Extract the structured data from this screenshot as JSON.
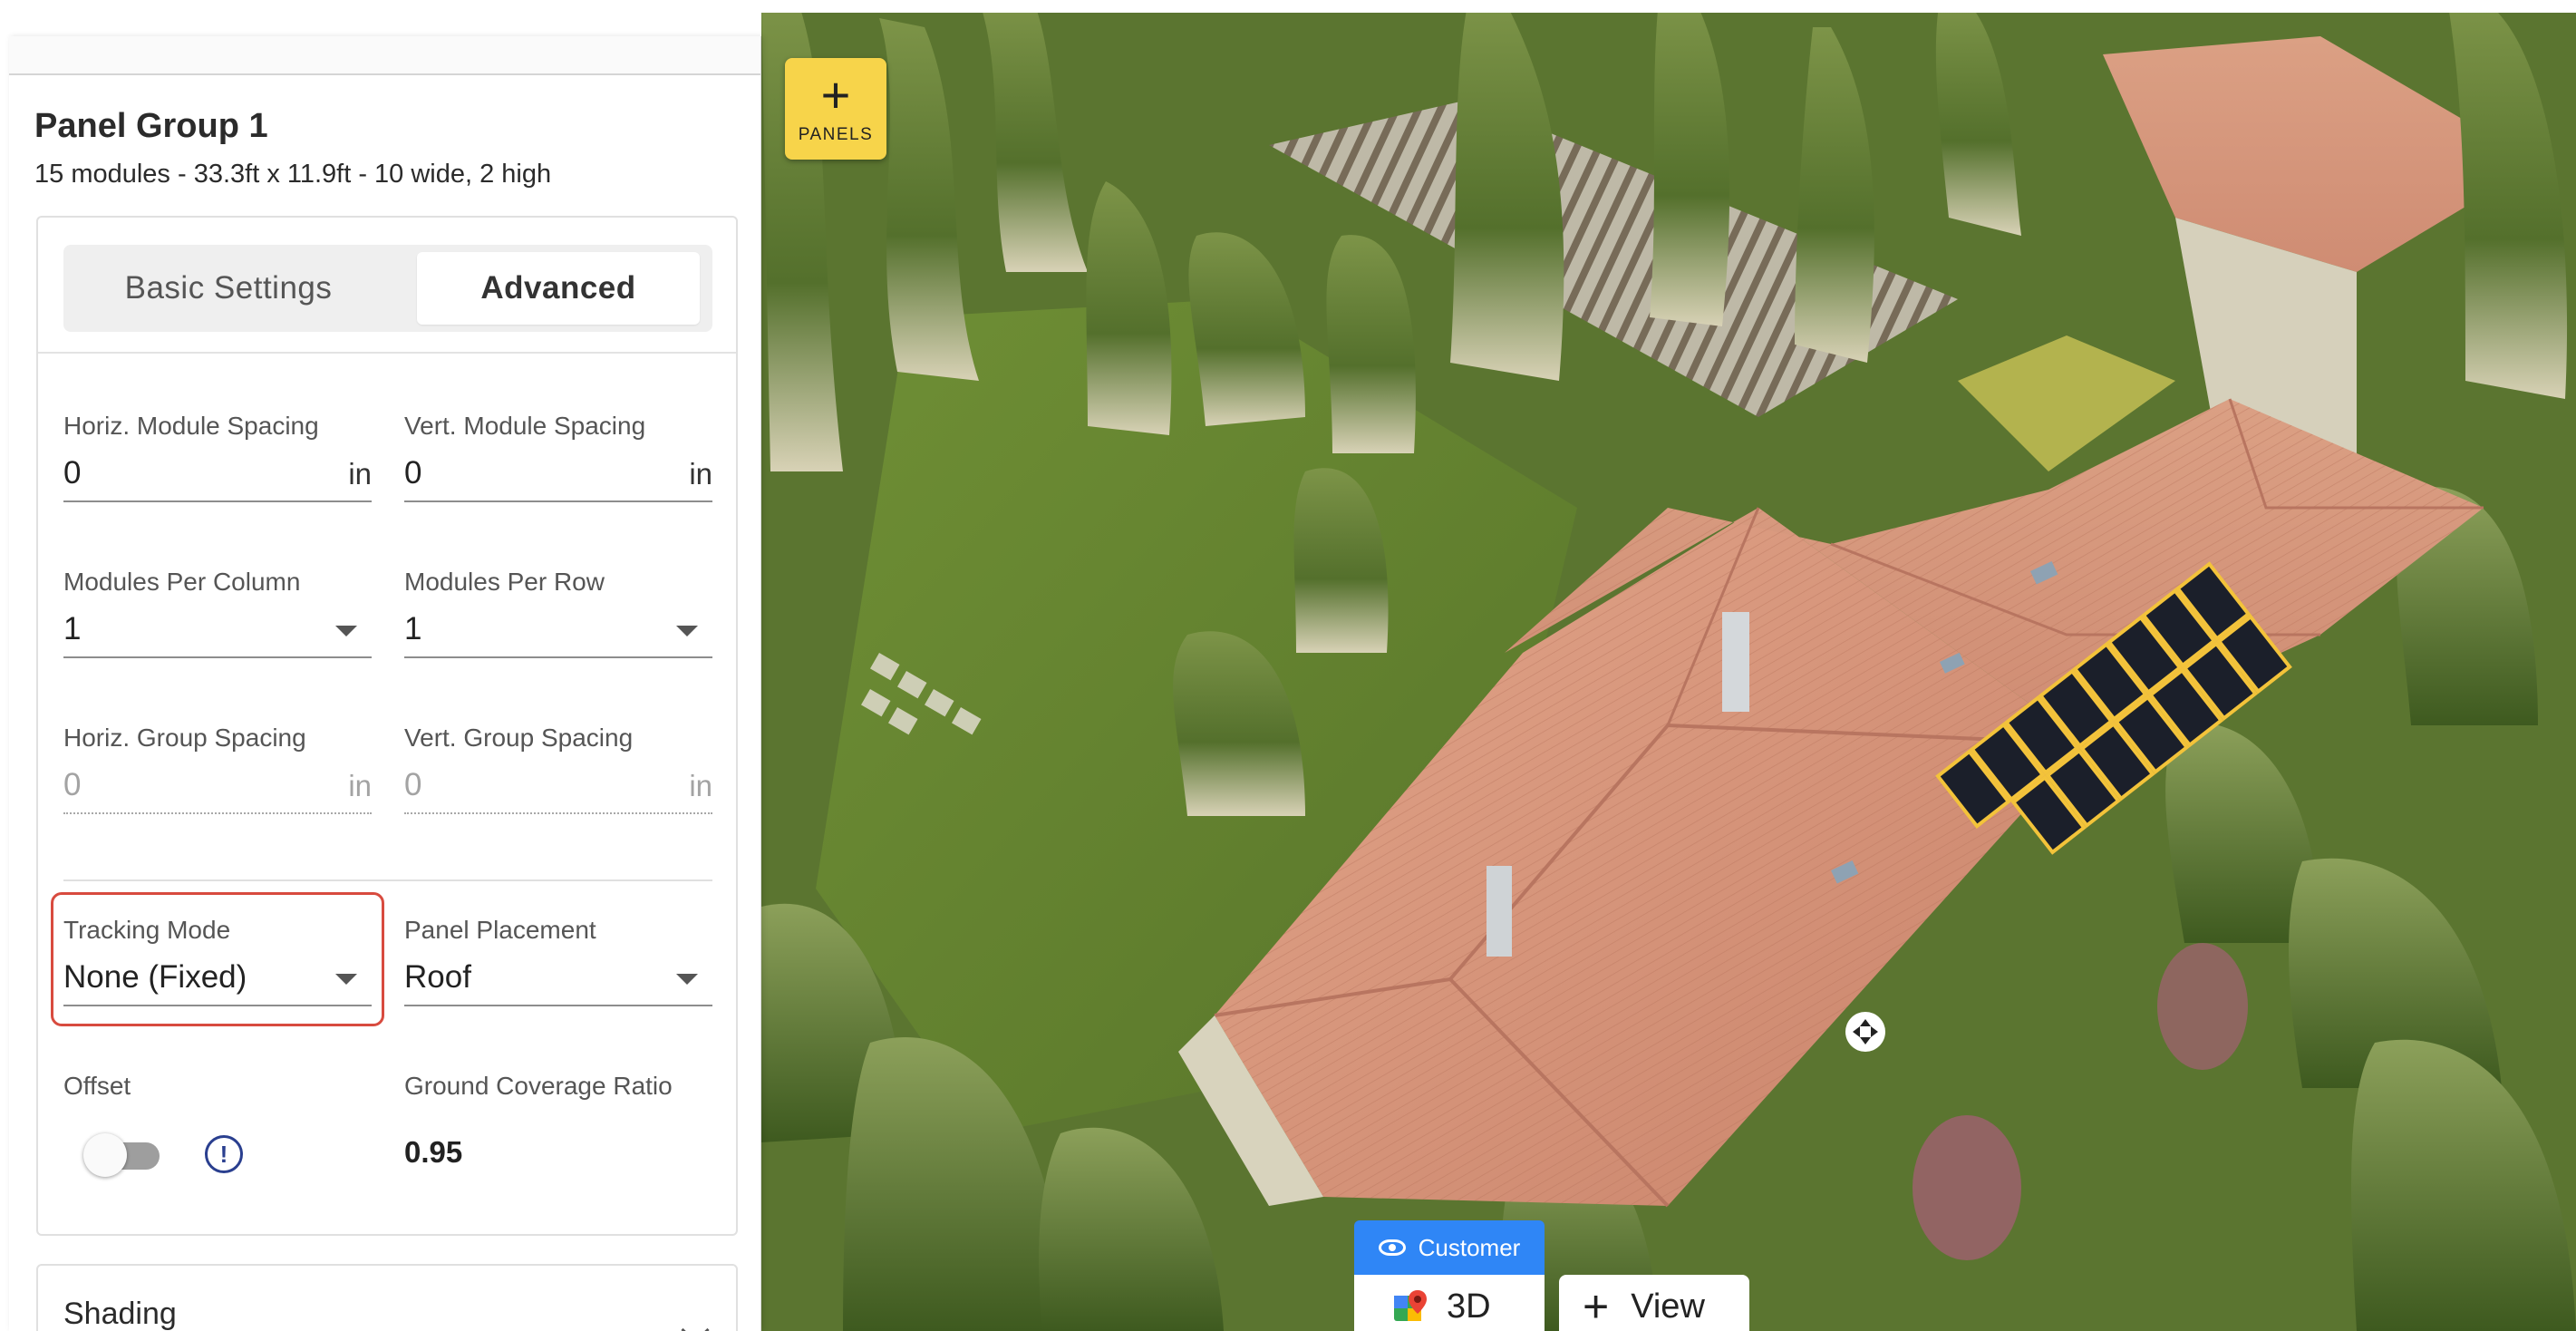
{
  "panel_group": {
    "title": "Panel Group 1",
    "subtitle": "15 modules - 33.3ft x 11.9ft - 10 wide, 2 high"
  },
  "tabs": {
    "basic": "Basic Settings",
    "advanced": "Advanced",
    "active": "Advanced"
  },
  "fields": {
    "horiz_module_spacing": {
      "label": "Horiz. Module Spacing",
      "value": "0",
      "unit": "in"
    },
    "vert_module_spacing": {
      "label": "Vert. Module Spacing",
      "value": "0",
      "unit": "in"
    },
    "modules_per_column": {
      "label": "Modules Per Column",
      "value": "1"
    },
    "modules_per_row": {
      "label": "Modules Per Row",
      "value": "1"
    },
    "horiz_group_spacing": {
      "label": "Horiz. Group Spacing",
      "value": "0",
      "unit": "in"
    },
    "vert_group_spacing": {
      "label": "Vert. Group Spacing",
      "value": "0",
      "unit": "in"
    },
    "tracking_mode": {
      "label": "Tracking Mode",
      "value": "None (Fixed)"
    },
    "panel_placement": {
      "label": "Panel Placement",
      "value": "Roof"
    },
    "offset": {
      "label": "Offset",
      "enabled": false
    },
    "ground_coverage_ratio": {
      "label": "Ground Coverage Ratio",
      "value": "0.95"
    }
  },
  "shading": {
    "title": "Shading"
  },
  "toolbar": {
    "panels_label": "PANELS"
  },
  "view_controls": {
    "customer_label": "Customer",
    "view3d_label": "3D",
    "view_label": "View"
  },
  "icons": [
    "plus-icon",
    "info-icon",
    "chevron-down-icon",
    "eye-icon",
    "google-maps-icon",
    "move-icon",
    "checkmark-icon"
  ],
  "colors": {
    "fab": "#f7d44a",
    "highlight": "#d84b3f",
    "customer": "#2f86f6",
    "info": "#2a3f8f",
    "roof": "#d99579"
  }
}
